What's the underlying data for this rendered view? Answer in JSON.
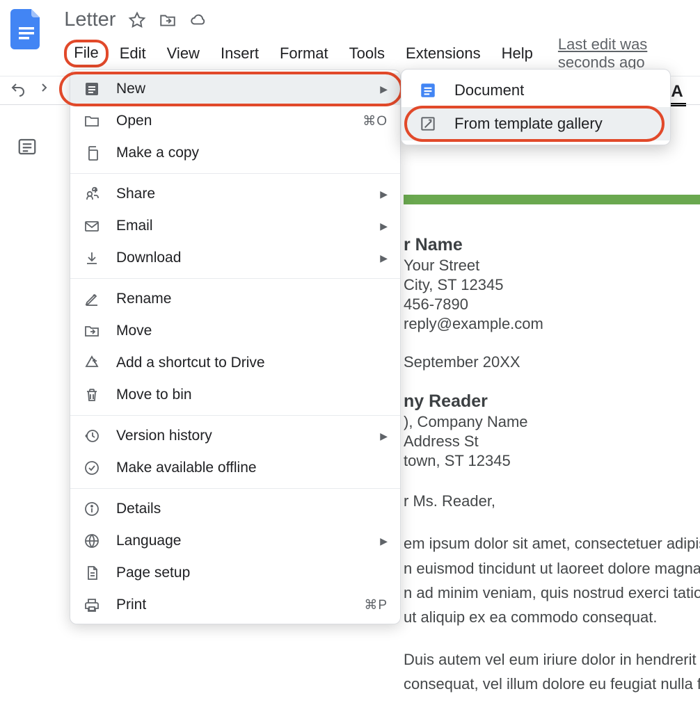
{
  "header": {
    "doc_title": "Letter",
    "menu": [
      "File",
      "Edit",
      "View",
      "Insert",
      "Format",
      "Tools",
      "Extensions",
      "Help"
    ],
    "last_edit": "Last edit was seconds ago"
  },
  "file_menu": {
    "new": "New",
    "open": "Open",
    "open_shortcut": "⌘O",
    "make_copy": "Make a copy",
    "share": "Share",
    "email": "Email",
    "download": "Download",
    "rename": "Rename",
    "move": "Move",
    "add_shortcut": "Add a shortcut to Drive",
    "move_to_bin": "Move to bin",
    "version_history": "Version history",
    "make_offline": "Make available offline",
    "details": "Details",
    "language": "Language",
    "page_setup": "Page setup",
    "print": "Print",
    "print_shortcut": "⌘P"
  },
  "new_submenu": {
    "document": "Document",
    "from_template": "From template gallery"
  },
  "doc": {
    "name": "r Name",
    "street": "Your Street",
    "city": "City, ST 12345",
    "phone": "456-7890",
    "email": "reply@example.com",
    "date": "September 20XX",
    "reader": "ny Reader",
    "role": "), Company Name",
    "addr": "Address St",
    "addr_city": "town, ST 12345",
    "dear": "r Ms. Reader,",
    "para1": "em ipsum dolor sit amet, consectetuer adipisc",
    "para2": "n euismod tincidunt ut laoreet dolore magna a",
    "para3": "n ad minim veniam, quis nostrud exerci tation",
    "para4": "ut aliquip ex ea commodo consequat.",
    "para5": "Duis autem vel eum iriure dolor in hendrerit in vu",
    "para6": "consequat, vel illum dolore eu feugiat nulla facilis"
  }
}
